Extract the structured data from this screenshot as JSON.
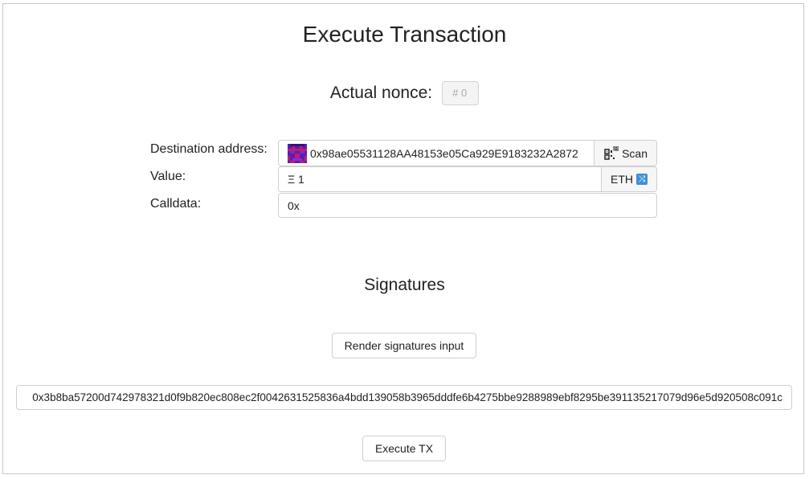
{
  "page": {
    "title": "Execute Transaction"
  },
  "nonce": {
    "label": "Actual nonce:",
    "placeholder": "# 0"
  },
  "destination": {
    "label": "Destination address:",
    "value": "0x98ae05531128AA48153e05Ca929E9183232A2872",
    "scan_label": "Scan",
    "avatar_icon": "blockie-identicon",
    "scan_icon": "qr-code-camera-icon"
  },
  "value_field": {
    "label": "Value:",
    "value": "Ξ 1",
    "unit_label": "ETH",
    "unit_icon": "swap-arrows-icon"
  },
  "calldata": {
    "label": "Calldata:",
    "value": "0x"
  },
  "signatures": {
    "title": "Signatures",
    "render_button_label": "Render signatures input",
    "value": "0x3b8ba57200d742978321d0f9b820ec808ec2f0042631525836a4bdd139058b3965dddfe6b4275bbe9288989ebf8295be391135217079d96e5d920508c091c"
  },
  "execute_button_label": "Execute TX",
  "colors": {
    "blockie_primary": "#5a1fa8",
    "blockie_secondary": "#c01a7a",
    "swap_icon": "#3d8fd8",
    "border": "#cfcfcf"
  }
}
